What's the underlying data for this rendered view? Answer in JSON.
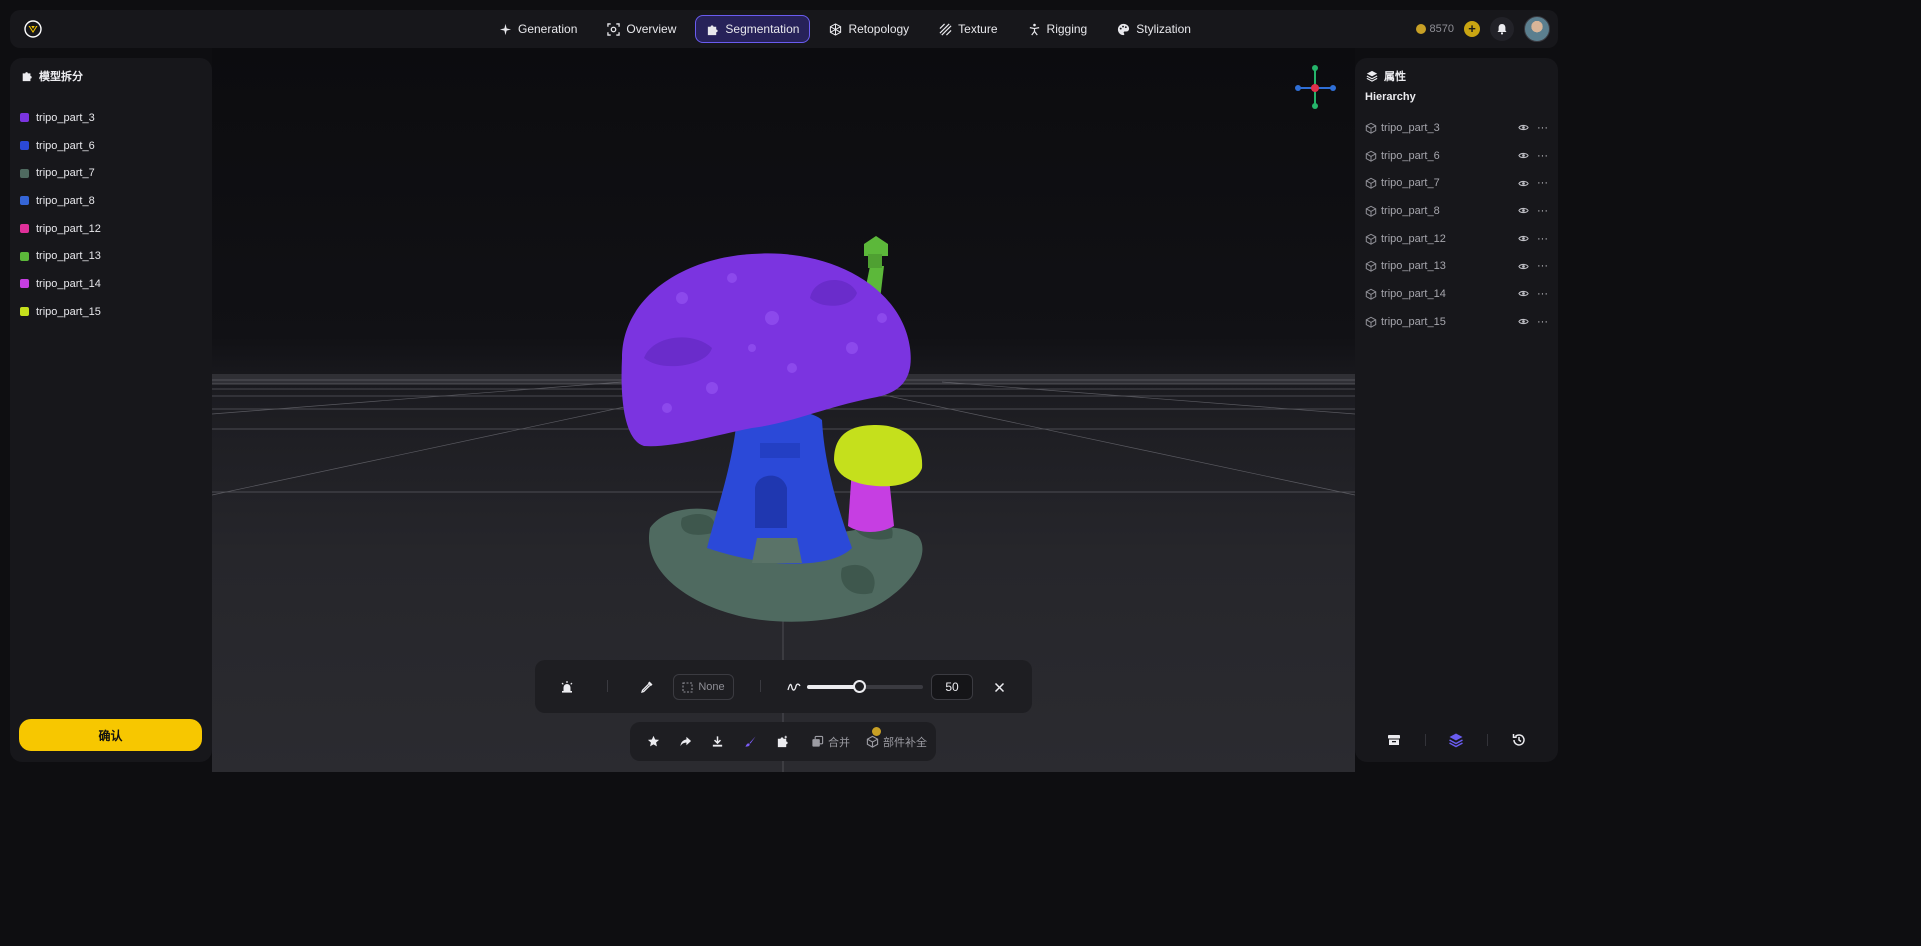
{
  "nav": {
    "tabs": [
      {
        "label": "Generation",
        "icon": "sparkle-icon"
      },
      {
        "label": "Overview",
        "icon": "scan-icon"
      },
      {
        "label": "Segmentation",
        "icon": "puzzle-icon",
        "active": true
      },
      {
        "label": "Retopology",
        "icon": "mesh-icon"
      },
      {
        "label": "Texture",
        "icon": "texture-icon"
      },
      {
        "label": "Rigging",
        "icon": "figure-icon"
      },
      {
        "label": "Stylization",
        "icon": "palette-icon"
      }
    ],
    "credits": "8570"
  },
  "left_panel": {
    "title": "模型拆分",
    "parts": [
      {
        "label": "tripo_part_3",
        "color": "#7b34e0"
      },
      {
        "label": "tripo_part_6",
        "color": "#2b49d8"
      },
      {
        "label": "tripo_part_7",
        "color": "#4f6a60"
      },
      {
        "label": "tripo_part_8",
        "color": "#3565d6"
      },
      {
        "label": "tripo_part_12",
        "color": "#e0309a"
      },
      {
        "label": "tripo_part_13",
        "color": "#5cb83a"
      },
      {
        "label": "tripo_part_14",
        "color": "#c63ee2"
      },
      {
        "label": "tripo_part_15",
        "color": "#c5e01c"
      }
    ],
    "confirm_label": "确认"
  },
  "right_panel": {
    "title": "属性",
    "hierarchy_title": "Hierarchy",
    "items": [
      "tripo_part_3",
      "tripo_part_6",
      "tripo_part_7",
      "tripo_part_8",
      "tripo_part_12",
      "tripo_part_13",
      "tripo_part_14",
      "tripo_part_15"
    ]
  },
  "brush_bar": {
    "selection_value": "None",
    "brush_size": "50",
    "brush_size_fraction": 0.45
  },
  "action_bar": {
    "merge_label": "合并",
    "complete_label": "部件补全"
  },
  "colors": {
    "accent": "#f7c700",
    "active_tab_border": "#6a5cf0",
    "cap": "#7b34e0",
    "stem": "#2b49d8",
    "base": "#4f6a60",
    "small_cap": "#c5e01c",
    "small_stem": "#c63ee2",
    "chimney": "#5cb83a"
  }
}
